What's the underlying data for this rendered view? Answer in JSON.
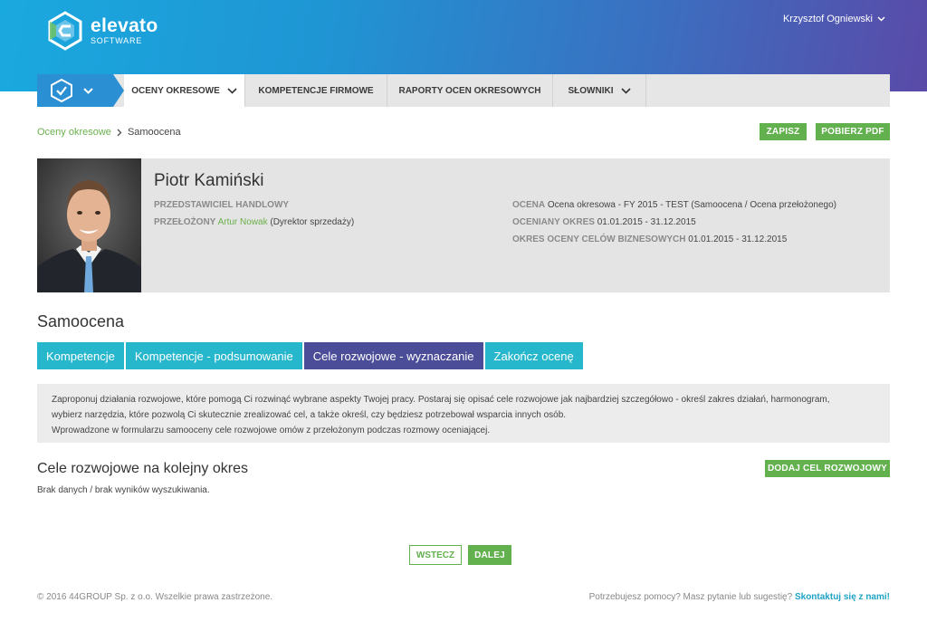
{
  "brand": {
    "name": "elevato",
    "sub": "SOFTWARE"
  },
  "user": {
    "name": "Krzysztof Ogniewski"
  },
  "nav": {
    "items": [
      {
        "label": "OCENY OKRESOWE"
      },
      {
        "label": "KOMPETENCJE FIRMOWE"
      },
      {
        "label": "RAPORTY OCEN OKRESOWYCH"
      },
      {
        "label": "SŁOWNIKI"
      }
    ]
  },
  "breadcrumb": {
    "parent": "Oceny okresowe",
    "current": "Samoocena"
  },
  "toolbar": {
    "save_label": "ZAPISZ",
    "pdf_label": "POBIERZ PDF"
  },
  "profile": {
    "name": "Piotr Kamiński",
    "position": "PRZEDSTAWICIEL HANDLOWY",
    "supervisor_label": "PRZEŁOŻONY",
    "supervisor_name": "Artur Nowak",
    "supervisor_role": "(Dyrektor sprzedaży)",
    "rating_label": "OCENA",
    "rating_value": "Ocena okresowa - FY 2015 - TEST (Samoocena / Ocena przełożonego)",
    "period_label": "OCENIANY OKRES",
    "period_value": "01.01.2015 - 31.12.2015",
    "goals_period_label": "OKRES OCENY CELÓW BIZNESOWYCH",
    "goals_period_value": "01.01.2015 - 31.12.2015"
  },
  "section": {
    "title": "Samoocena"
  },
  "tabs": [
    {
      "label": "Kompetencje"
    },
    {
      "label": "Kompetencje - podsumowanie"
    },
    {
      "label": "Cele rozwojowe - wyznaczanie"
    },
    {
      "label": "Zakończ ocenę"
    }
  ],
  "info": {
    "line1": "Zaproponuj działania rozwojowe, które pomogą Ci rozwinąć wybrane aspekty Twojej pracy. Postaraj się opisać cele rozwojowe jak najbardziej szczegółowo - określ zakres działań, harmonogram,",
    "line2": "wybierz narzędzia, które pozwolą Ci skutecznie zrealizować cel, a także określ, czy będziesz potrzebował wsparcia innych osób.",
    "line3": "Wprowadzone w formularzu samooceny cele rozwojowe omów z przełożonym podczas rozmowy oceniającej."
  },
  "goals": {
    "title": "Cele rozwojowe na kolejny okres",
    "add_label": "DODAJ CEL ROZWOJOWY",
    "empty": "Brak danych / brak wyników wyszukiwania."
  },
  "pager": {
    "back_label": "WSTECZ",
    "next_label": "DALEJ"
  },
  "footer": {
    "copyright": "© 2016 44GROUP Sp. z o.o. Wszelkie prawa zastrzeżone.",
    "help_text": "Potrzebujesz pomocy? Masz pytanie lub sugestię?",
    "contact_label": "Skontaktuj się z nami!"
  },
  "colors": {
    "accent_green": "#62b14e",
    "tab_teal": "#26b7cc",
    "tab_active": "#4c4d99",
    "nav_blue": "#2a8fd3"
  }
}
